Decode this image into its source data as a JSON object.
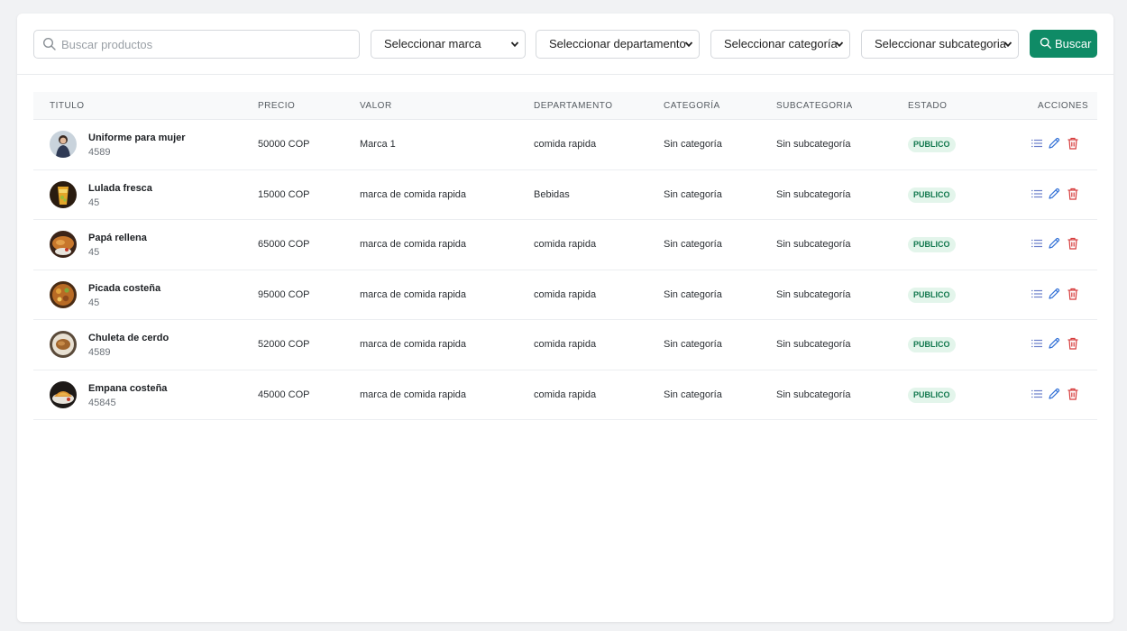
{
  "search": {
    "placeholder": "Buscar productos",
    "value": ""
  },
  "filters": {
    "marca": "Seleccionar marca",
    "departamento": "Seleccionar departamento",
    "categoria": "Seleccionar categoría",
    "subcategoria": "Seleccionar subcategoria"
  },
  "buscar_label": "Buscar",
  "columns": {
    "titulo": "TITULO",
    "precio": "PRECIO",
    "valor": "VALOR",
    "departamento": "DEPARTAMENTO",
    "categoria": "CATEGORÍA",
    "subcategoria": "SUBCATEGORIA",
    "estado": "ESTADO",
    "acciones": "ACCIONES"
  },
  "rows": [
    {
      "title": "Uniforme para mujer",
      "code": "4589",
      "price": "50000 COP",
      "brand": "Marca 1",
      "department": "comida rapida",
      "category": "Sin categoría",
      "subcategory": "Sin subcategoría",
      "status": "PUBLICO",
      "thumb": "person-photo"
    },
    {
      "title": "Lulada fresca",
      "code": "45",
      "price": "15000 COP",
      "brand": "marca de comida rapida",
      "department": "Bebidas",
      "category": "Sin categoría",
      "subcategory": "Sin subcategoría",
      "status": "PUBLICO",
      "thumb": "drink-photo"
    },
    {
      "title": "Papá rellena",
      "code": "45",
      "price": "65000 COP",
      "brand": "marca de comida rapida",
      "department": "comida rapida",
      "category": "Sin categoría",
      "subcategory": "Sin subcategoría",
      "status": "PUBLICO",
      "thumb": "food-photo"
    },
    {
      "title": "Picada costeña",
      "code": "45",
      "price": "95000 COP",
      "brand": "marca de comida rapida",
      "department": "comida rapida",
      "category": "Sin categoría",
      "subcategory": "Sin subcategoría",
      "status": "PUBLICO",
      "thumb": "food-photo"
    },
    {
      "title": "Chuleta de cerdo",
      "code": "4589",
      "price": "52000 COP",
      "brand": "marca de comida rapida",
      "department": "comida rapida",
      "category": "Sin categoría",
      "subcategory": "Sin subcategoría",
      "status": "PUBLICO",
      "thumb": "food-photo"
    },
    {
      "title": "Empana costeña",
      "code": "45845",
      "price": "45000 COP",
      "brand": "marca de comida rapida",
      "department": "comida rapida",
      "category": "Sin categoría",
      "subcategory": "Sin subcategoría",
      "status": "PUBLICO",
      "thumb": "food-photo"
    }
  ],
  "colors": {
    "accent": "#0f8b66",
    "badge_bg": "#e3f5eb",
    "badge_text": "#12784e",
    "list_icon": "#6b7ec9",
    "edit_icon": "#2f6fd6",
    "delete_icon": "#d63b3b"
  },
  "icons": {
    "search": "search-icon",
    "details": "list-icon",
    "edit": "pencil-icon",
    "delete": "trash-icon"
  }
}
